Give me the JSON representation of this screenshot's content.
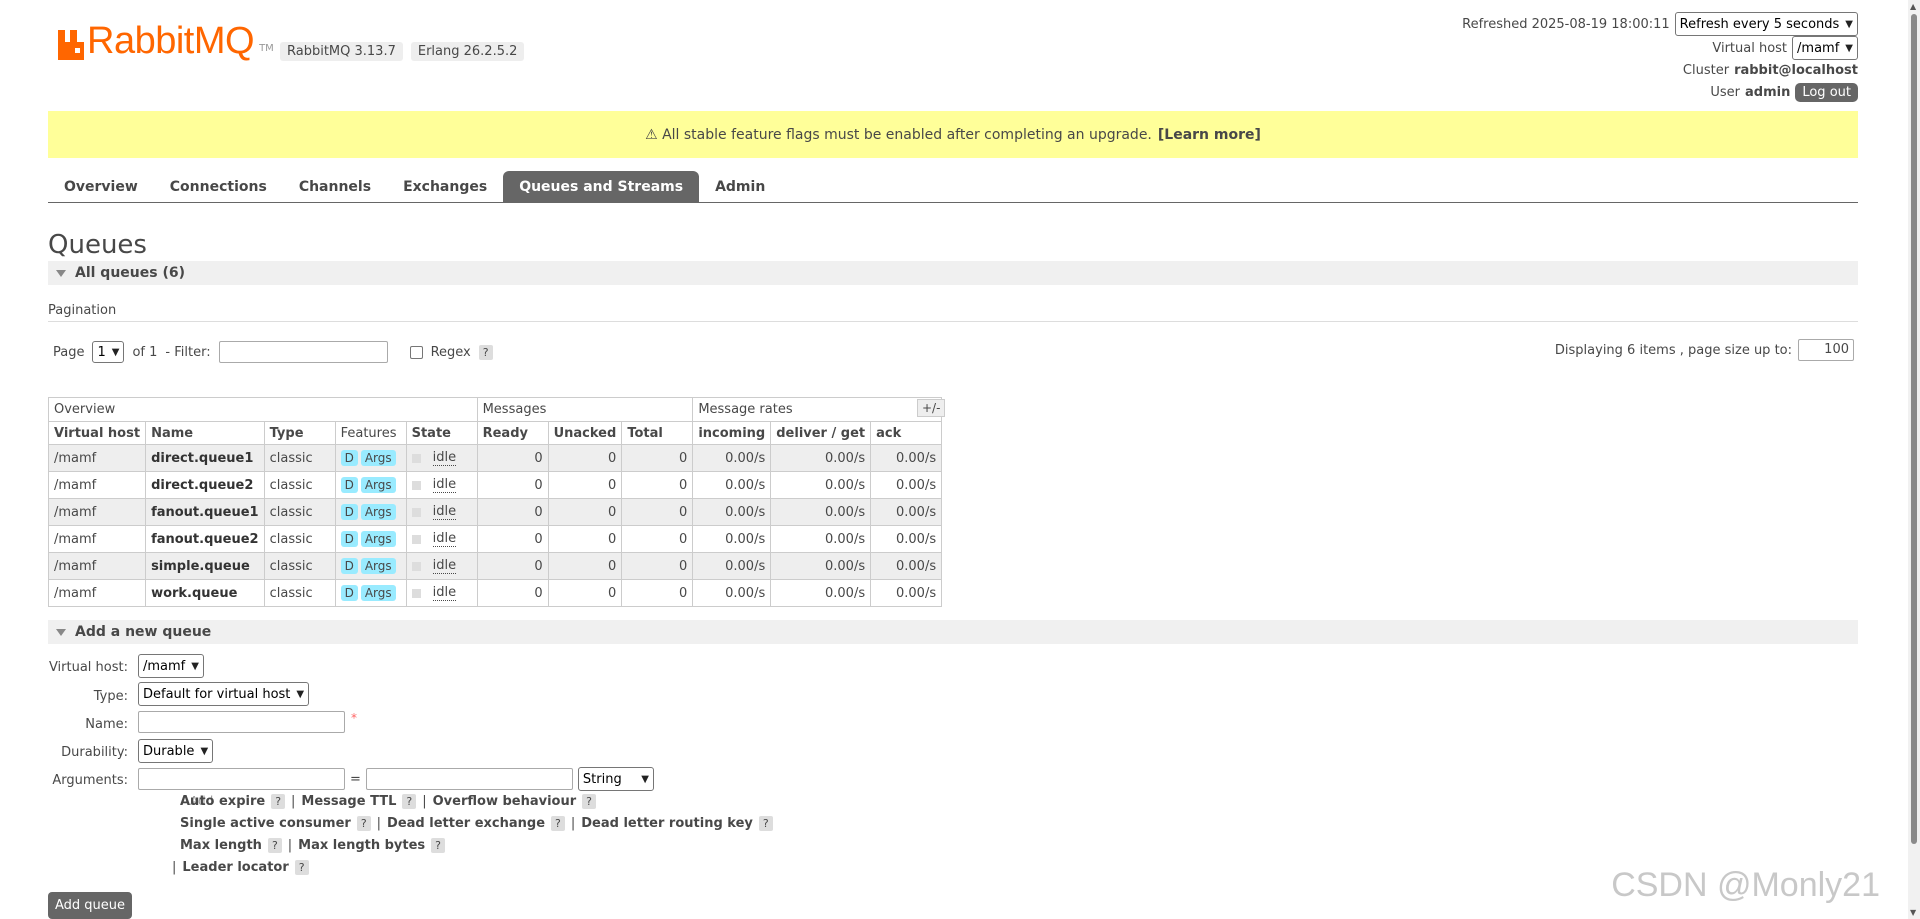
{
  "header": {
    "logo_text": "RabbitMQ",
    "logo_tm": "TM",
    "version": "RabbitMQ 3.13.7",
    "erlang": "Erlang 26.2.5.2",
    "refreshed_label": "Refreshed 2025-08-19 18:00:11",
    "refresh_select": "Refresh every 5 seconds",
    "vhost_label": "Virtual host",
    "vhost_select": "/mamf",
    "cluster_label": "Cluster",
    "cluster_value": "rabbit@localhost",
    "user_label": "User",
    "user_value": "admin",
    "logout_label": "Log out"
  },
  "banner": {
    "text": "⚠ All stable feature flags must be enabled after completing an upgrade.",
    "link": "[Learn more]"
  },
  "nav": {
    "tabs": [
      "Overview",
      "Connections",
      "Channels",
      "Exchanges",
      "Queues and Streams",
      "Admin"
    ],
    "active": "Queues and Streams"
  },
  "page_title": "Queues",
  "all_queues": "All queues (6)",
  "pagination": {
    "label": "Pagination",
    "page_label": "Page",
    "page_value": "1",
    "of_label": "of 1",
    "filter_label": "- Filter:",
    "regex_label": "Regex",
    "help": "?",
    "display_label": "Displaying 6 items , page size up to:",
    "page_size": "100"
  },
  "table": {
    "groups": [
      "Overview",
      "Messages",
      "Message rates"
    ],
    "toggle": "+/-",
    "columns": [
      "Virtual host",
      "Name",
      "Type",
      "Features",
      "State",
      "Ready",
      "Unacked",
      "Total",
      "incoming",
      "deliver / get",
      "ack"
    ],
    "feature_d": "D",
    "feature_args": "Args",
    "rows": [
      {
        "vhost": "/mamf",
        "name": "direct.queue1",
        "type": "classic",
        "state": "idle",
        "ready": "0",
        "unacked": "0",
        "total": "0",
        "incoming": "0.00/s",
        "deliver": "0.00/s",
        "ack": "0.00/s"
      },
      {
        "vhost": "/mamf",
        "name": "direct.queue2",
        "type": "classic",
        "state": "idle",
        "ready": "0",
        "unacked": "0",
        "total": "0",
        "incoming": "0.00/s",
        "deliver": "0.00/s",
        "ack": "0.00/s"
      },
      {
        "vhost": "/mamf",
        "name": "fanout.queue1",
        "type": "classic",
        "state": "idle",
        "ready": "0",
        "unacked": "0",
        "total": "0",
        "incoming": "0.00/s",
        "deliver": "0.00/s",
        "ack": "0.00/s"
      },
      {
        "vhost": "/mamf",
        "name": "fanout.queue2",
        "type": "classic",
        "state": "idle",
        "ready": "0",
        "unacked": "0",
        "total": "0",
        "incoming": "0.00/s",
        "deliver": "0.00/s",
        "ack": "0.00/s"
      },
      {
        "vhost": "/mamf",
        "name": "simple.queue",
        "type": "classic",
        "state": "idle",
        "ready": "0",
        "unacked": "0",
        "total": "0",
        "incoming": "0.00/s",
        "deliver": "0.00/s",
        "ack": "0.00/s"
      },
      {
        "vhost": "/mamf",
        "name": "work.queue",
        "type": "classic",
        "state": "idle",
        "ready": "0",
        "unacked": "0",
        "total": "0",
        "incoming": "0.00/s",
        "deliver": "0.00/s",
        "ack": "0.00/s"
      }
    ]
  },
  "add_queue": {
    "section": "Add a new queue",
    "vhost_label": "Virtual host:",
    "vhost_value": "/mamf",
    "type_label": "Type:",
    "type_value": "Default for virtual host",
    "name_label": "Name:",
    "required": "*",
    "durability_label": "Durability:",
    "durability_value": "Durable",
    "arguments_label": "Arguments:",
    "equals": "=",
    "arg_type": "String",
    "add_link": "Add",
    "arg_line1": [
      "Auto expire",
      "Message TTL",
      "Overflow behaviour"
    ],
    "arg_line2": [
      "Single active consumer",
      "Dead letter exchange",
      "Dead letter routing key"
    ],
    "arg_line3": [
      "Max length",
      "Max length bytes"
    ],
    "arg_line4": [
      "Leader locator"
    ],
    "separator": "|",
    "help": "?",
    "button": "Add queue"
  },
  "watermark": "CSDN @Monly21",
  "colors": {
    "brand": "#ff6600",
    "banner": "#ffff99",
    "tab_active": "#666666",
    "tag": "#99ebff"
  }
}
